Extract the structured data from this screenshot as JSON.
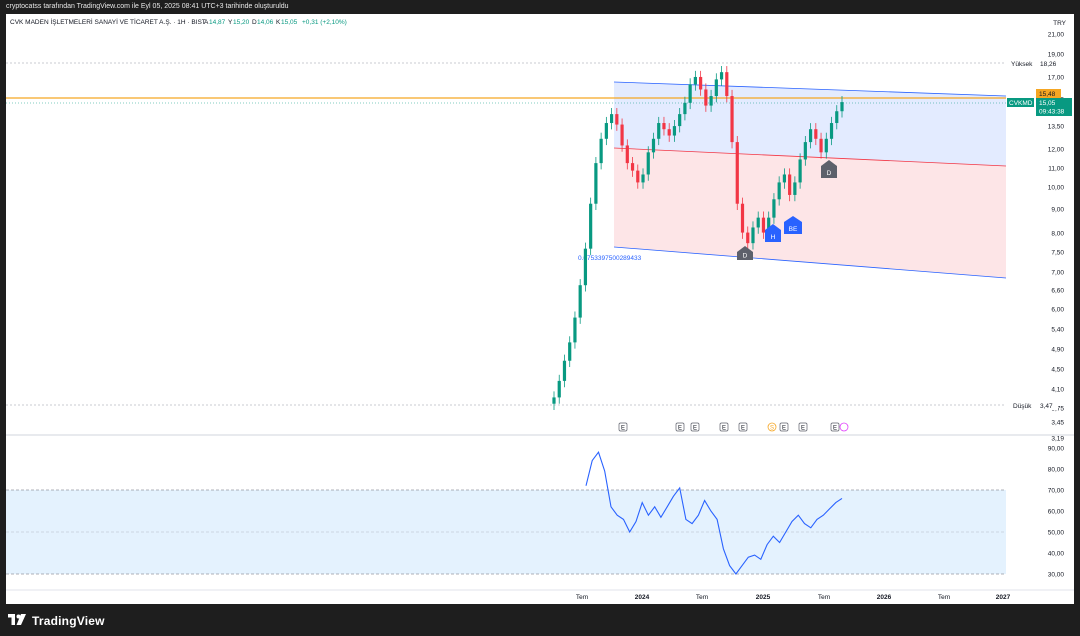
{
  "header": {
    "snapshot_text": "cryptocatss tarafından TradingView.com ile Eyl 05, 2025 08:41 UTC+3 tarihinde oluşturuldu"
  },
  "legend": {
    "symbol": "CVK MADEN İŞLETMELERİ SANAYİ VE TİCARET A.Ş. · 1H · BIST",
    "open_label": "A",
    "open": "14,87",
    "high_label": "Y",
    "high": "15,20",
    "low_label": "D",
    "low": "14,06",
    "close_label": "K",
    "close": "15,05",
    "change": "+0,31 (+2,10%)"
  },
  "currency": "TRY",
  "price_axis": {
    "ticks": [
      "21,00",
      "19,00",
      "17,00",
      "15,50",
      "13,50",
      "12,00",
      "11,00",
      "10,00",
      "9,00",
      "8,00",
      "7,50",
      "7,00",
      "6,60",
      "6,00",
      "5,40",
      "4,90",
      "4,50",
      "4,10",
      "3,75",
      "3,45",
      "3,19"
    ],
    "high_label": "Yüksek",
    "high_value": "18,26",
    "low_label": "Düşük",
    "low_value": "3,47",
    "orange_level": "15,48",
    "ticker": "CVKMD",
    "ticker_price": "15,05",
    "countdown": "09:43:38"
  },
  "rsi_axis": {
    "ticks": [
      "90,00",
      "80,00",
      "70,00",
      "60,00",
      "50,00",
      "40,00",
      "30,00"
    ]
  },
  "time_axis": {
    "labels": [
      "Tem",
      "2024",
      "Tem",
      "2025",
      "Tem",
      "2026",
      "Tem",
      "2027"
    ]
  },
  "annotations": {
    "fib_value": "0.0753397500289433",
    "markers": [
      "D",
      "H",
      "BE",
      "D"
    ],
    "events": [
      "E",
      "E",
      "E",
      "E",
      "E",
      "S",
      "E",
      "E",
      "E"
    ]
  },
  "colors": {
    "up": "#089981",
    "down": "#f23645",
    "channel_blue": "#2962ff",
    "channel_red": "#f23645",
    "orange": "#f5a623",
    "rsi_line": "#2962ff",
    "marker_gray": "#5d606b",
    "marker_blue": "#2962ff"
  },
  "brand": {
    "name": "TradingView",
    "logo": "tradingview-logo-icon"
  },
  "chart_data": {
    "type": "candlestick",
    "timeframe": "1H",
    "close_series_approx": [
      3.6,
      3.9,
      4.3,
      4.7,
      5.3,
      6.2,
      7.4,
      9.2,
      11.2,
      12.6,
      13.6,
      14.2,
      13.5,
      12.2,
      11.2,
      10.8,
      10.2,
      10.6,
      11.8,
      12.6,
      13.6,
      13.2,
      12.8,
      13.4,
      14.2,
      15.0,
      16.4,
      17.0,
      16.0,
      14.8,
      15.5,
      16.8,
      17.4,
      15.5,
      12.4,
      9.2,
      8.0,
      7.6,
      8.2,
      8.6,
      8.0,
      8.6,
      9.4,
      10.2,
      10.6,
      9.6,
      10.2,
      11.4,
      12.4,
      13.2,
      12.6,
      11.8,
      12.6,
      13.6,
      14.4,
      15.05
    ],
    "rsi_approx": [
      72,
      84,
      88,
      79,
      62,
      58,
      56,
      50,
      55,
      64,
      58,
      62,
      57,
      62,
      67,
      71,
      56,
      54,
      58,
      65,
      60,
      56,
      42,
      34,
      30,
      34,
      38,
      39,
      37,
      44,
      48,
      45,
      50,
      55,
      58,
      54,
      52,
      56,
      58,
      61,
      64,
      66
    ],
    "rsi_ylim": [
      30,
      90
    ],
    "rsi_band": [
      30,
      70
    ],
    "y_scale": "log"
  }
}
